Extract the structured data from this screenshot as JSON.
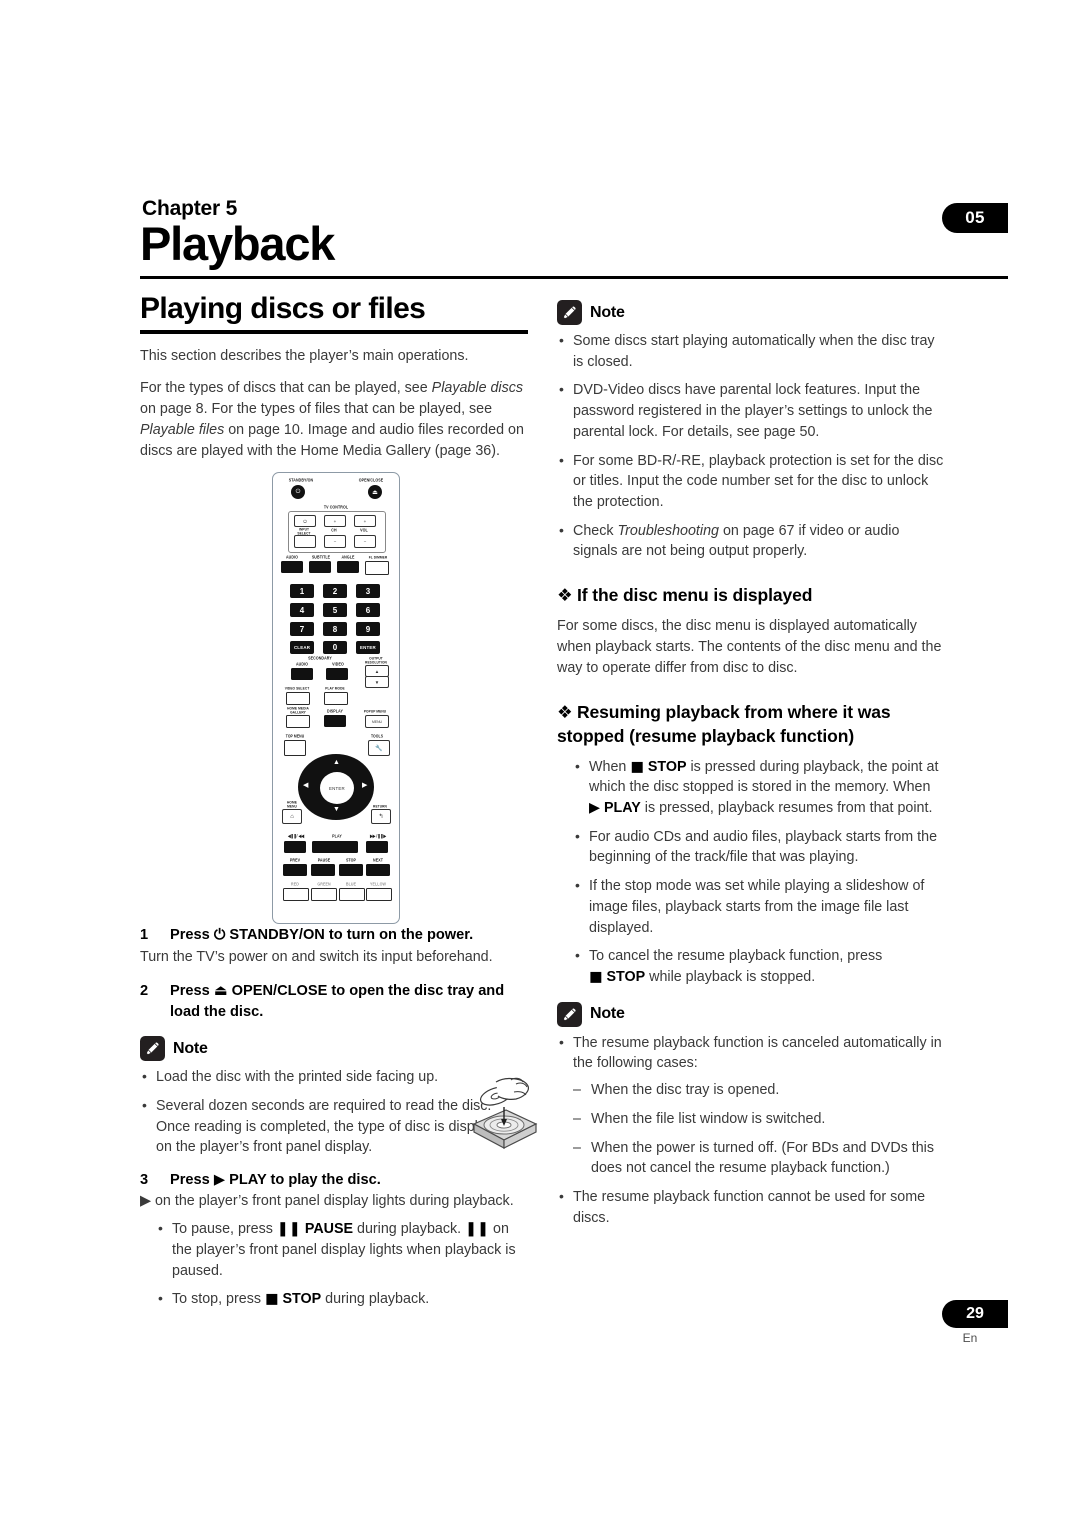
{
  "page": {
    "chapter_label": "Chapter 5",
    "chapter_title": "Playback",
    "marker_top": "05",
    "marker_bottom": "29",
    "language_code": "En"
  },
  "left_column": {
    "section_title": "Playing discs or files",
    "intro_1": "This section describes the player’s main operations.",
    "intro_2_parts": {
      "a": "For the types of discs that can be played, see ",
      "b_italic": "Playable discs",
      "c": " on page 8. For the types of files that can be played, see ",
      "d_italic": "Playable files",
      "e": " on page 10. Image and audio files recorded on discs are played with the Home Media Gallery (page 36)."
    },
    "steps": [
      {
        "number": "1",
        "title_pre": "Press ",
        "title_glyph": "⏻",
        "title_post": " STANDBY/ON to turn on the power.",
        "body": "Turn the TV’s power on and switch its input beforehand."
      },
      {
        "number": "2",
        "title_pre": "Press ",
        "title_glyph": "⏏",
        "title_post": " OPEN/CLOSE to open the disc tray and load the disc.",
        "body": ""
      },
      {
        "number": "3",
        "title_pre": "Press ",
        "title_glyph": "▶",
        "title_post": " PLAY to play the disc.",
        "body": "▶ on the player’s front panel display lights during playback."
      }
    ],
    "note_label": "Note",
    "note_bullets": [
      "Load the disc with the printed side facing up.",
      "Several dozen seconds are required to read the disc. Once reading is completed, the type of disc is displayed on the player’s front panel display."
    ],
    "play_bullets": [
      {
        "a": "To pause, press ",
        "g1": "❚❚",
        "b_bold": " PAUSE",
        "c": " during playback. ",
        "g2": "❚❚",
        "d": " on the player’s front panel display lights when playback is paused."
      },
      {
        "a": "To stop, press ",
        "g1": "■",
        "b_bold": " STOP",
        "c": " during playback."
      }
    ]
  },
  "right_column": {
    "note1_label": "Note",
    "note1_bullets": [
      "Some discs start playing automatically when the disc tray is closed.",
      "DVD-Video discs have parental lock features. Input the password registered in the player’s settings to unlock the parental lock. For details, see page 50.",
      "For some BD-R/-RE, playback protection is set for the disc or titles. Input the code number set for the disc to unlock the protection."
    ],
    "note1_last_bullet": {
      "a": "Check ",
      "b_italic": "Troubleshooting",
      "c": " on page 67 if video or audio signals are not being output properly."
    },
    "heading_disc_menu": "If the disc menu is displayed",
    "disc_menu_body": "For some discs, the disc menu is displayed automatically when playback starts. The contents of the disc menu and the way to operate differ from disc to disc.",
    "heading_resume": "Resuming playback from where it was stopped (resume playback function)",
    "resume_bullets": [
      {
        "a": "When ",
        "g1": "■",
        "b_bold": " STOP",
        "c": " is pressed during playback, the point at which the disc stopped is stored in the memory. When ",
        "g2": "▶",
        "d_bold": " PLAY",
        "e": " is pressed, playback resumes from that point."
      },
      {
        "plain": "For audio CDs and audio files, playback starts from the beginning of the track/file that was playing."
      },
      {
        "plain": "If the stop mode was set while playing a slideshow of image files, playback starts from the image file last displayed."
      },
      {
        "a": "To cancel the resume playback function, press ",
        "g1": "■",
        "b_bold": " STOP",
        "c": " while playback is stopped."
      }
    ],
    "note2_label": "Note",
    "note2_intro": "The resume playback function is canceled automatically in the following cases:",
    "note2_dashes": [
      "When the disc tray is opened.",
      "When the file list window is switched.",
      "When the power is turned off. (For BDs and DVDs this does not cancel the resume playback function.)"
    ],
    "note2_last": "The resume playback function cannot be used for some discs."
  },
  "remote": {
    "labels": {
      "standby_on": "STANDBY/ON",
      "open_close": "OPEN/CLOSE",
      "tv_control": "TV CONTROL",
      "input_select": "INPUT SELECT",
      "ch": "CH",
      "vol": "VOL",
      "audio": "AUDIO",
      "subtitle": "SUBTITLE",
      "angle": "ANGLE",
      "fl_dimmer": "FL DIMMER",
      "secondary": "SECONDARY",
      "secondary_audio": "AUDIO",
      "secondary_video": "VIDEO",
      "output_resolution": "OUTPUT RESOLUTION",
      "video_select": "VIDEO SELECT",
      "play_mode": "PLAY MODE",
      "home_media_gallery": "HOME MEDIA GALLERY",
      "display": "DISPLAY",
      "popup_menu": "POPUP MENU",
      "menu": "MENU",
      "top_menu": "TOP MENU",
      "tools": "TOOLS",
      "home_menu": "HOME MENU",
      "return": "RETURN",
      "enter": "ENTER",
      "clear": "CLEAR",
      "play": "PLAY",
      "prev": "PREV",
      "pause": "PAUSE",
      "stop": "STOP",
      "next": "NEXT",
      "red": "RED",
      "green": "GREEN",
      "blue": "BLUE",
      "yellow": "YELLOW",
      "scan_rev": "◀❚❚/ ◀◀",
      "scan_fwd": "▶▶ /❚❚▶"
    },
    "keypad": [
      "1",
      "2",
      "3",
      "4",
      "5",
      "6",
      "7",
      "8",
      "9",
      "0"
    ]
  }
}
